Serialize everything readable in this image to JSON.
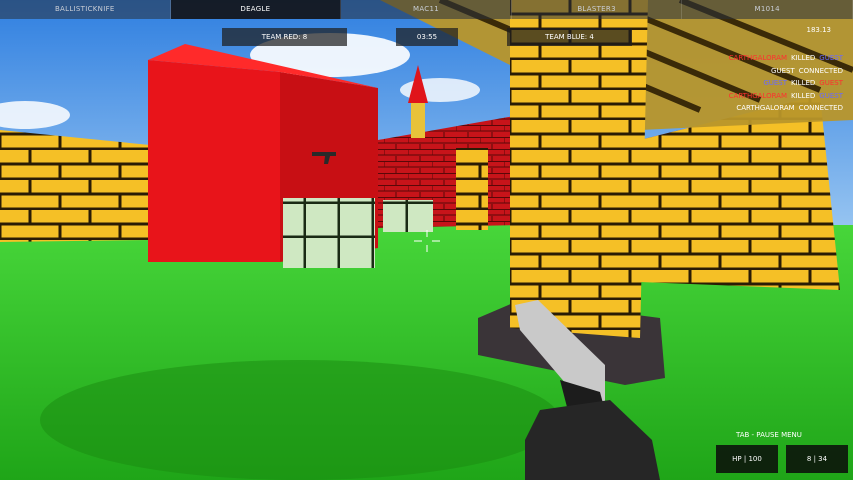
{
  "weapons": [
    "BALLISTICKNIFE",
    "DEAGLE",
    "MAC11",
    "BLASTER3",
    "M1014"
  ],
  "active_weapon_index": 1,
  "scoreboard": {
    "team_red": "TEAM RED: 8",
    "timer": "03:55",
    "team_blue": "TEAM BLUE: 4"
  },
  "fps": "183.13",
  "killfeed": [
    {
      "actor": "CARTHGALORAM",
      "actor_team": "red",
      "verb": "KILLED",
      "target": "GUEST",
      "target_team": "blue"
    },
    {
      "actor": "GUEST",
      "actor_team": "white",
      "verb": "CONNECTED",
      "target": "",
      "target_team": ""
    },
    {
      "actor": "GUEST",
      "actor_team": "blue",
      "verb": "KILLED",
      "target": "GUEST",
      "target_team": "red"
    },
    {
      "actor": "CARTHGALORAM",
      "actor_team": "red",
      "verb": "KILLED",
      "target": "GUEST",
      "target_team": "blue"
    },
    {
      "actor": "CARTHGALORAM",
      "actor_team": "white",
      "verb": "CONNECTED",
      "target": "",
      "target_team": ""
    }
  ],
  "hud": {
    "pause_hint": "TAB - PAUSE MENU",
    "health": "HP | 100",
    "ammo": "8 | 34"
  },
  "colors": {
    "sky": "#4a8fe0",
    "grass": "#33c825",
    "wall_red": "#e8141a",
    "brick_yellow": "#f6c22a",
    "hud_bg": "#0a0a0a"
  }
}
